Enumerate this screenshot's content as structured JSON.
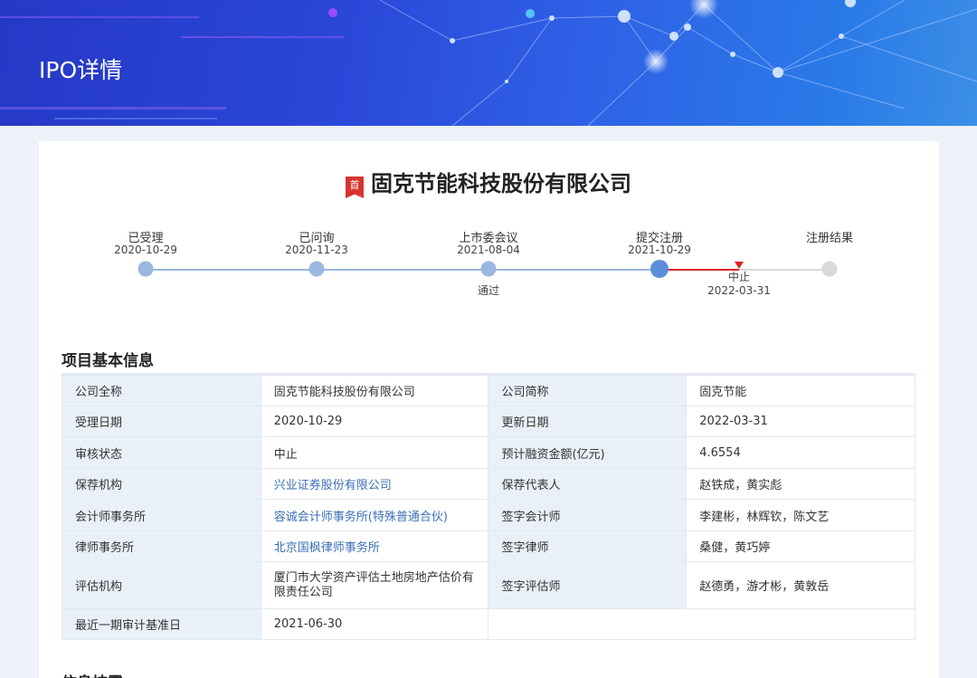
{
  "header": {
    "title": "IPO详情"
  },
  "company": {
    "badge": "首",
    "name": "固克节能科技股份有限公司"
  },
  "timeline": {
    "steps": [
      {
        "label": "已受理",
        "date": "2020-10-29",
        "note": ""
      },
      {
        "label": "已问询",
        "date": "2020-11-23",
        "note": ""
      },
      {
        "label": "上市委会议",
        "date": "2021-08-04",
        "note": "通过"
      },
      {
        "label": "提交注册",
        "date": "2021-10-29",
        "note": ""
      },
      {
        "label": "注册结果",
        "date": "",
        "note": ""
      }
    ],
    "termination": {
      "label": "中止",
      "date": "2022-03-31"
    },
    "colors": {
      "track": "#9ab7df",
      "current": "#5a8ed9",
      "terminated": "#e02020",
      "pending": "#d9d9d9"
    }
  },
  "basic_info": {
    "title": "项目基本信息",
    "rows": [
      [
        {
          "k": "公司全称",
          "v": "固克节能科技股份有限公司"
        },
        {
          "k": "公司简称",
          "v": "固克节能"
        }
      ],
      [
        {
          "k": "受理日期",
          "v": "2020-10-29"
        },
        {
          "k": "更新日期",
          "v": "2022-03-31"
        }
      ],
      [
        {
          "k": "审核状态",
          "v": "中止"
        },
        {
          "k": "预计融资金额(亿元)",
          "v": "4.6554"
        }
      ],
      [
        {
          "k": "保荐机构",
          "v": "兴业证券股份有限公司"
        },
        {
          "k": "保荐代表人",
          "v": "赵铁成，黄实彪"
        }
      ],
      [
        {
          "k": "会计师事务所",
          "v": "容诚会计师事务所(特殊普通合伙)"
        },
        {
          "k": "签字会计师",
          "v": "李建彬，林辉钦，陈文艺"
        }
      ],
      [
        {
          "k": "律师事务所",
          "v": "北京国枫律师事务所"
        },
        {
          "k": "签字律师",
          "v": "桑健，黄巧婷"
        }
      ],
      [
        {
          "k": "评估机构",
          "v": "厦门市大学资产评估土地房地产估价有限责任公司"
        },
        {
          "k": "签字评估师",
          "v": "赵德勇，游才彬，黄敦岳"
        }
      ],
      [
        {
          "k": "最近一期审计基准日",
          "v": "2021-06-30"
        }
      ]
    ]
  },
  "next_section": {
    "title": "信息披露"
  }
}
